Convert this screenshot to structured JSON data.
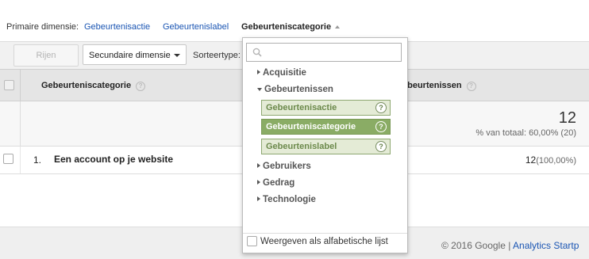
{
  "primary": {
    "label": "Primaire dimensie:",
    "links": [
      "Gebeurtenisactie",
      "Gebeurtenislabel"
    ],
    "active": "Gebeurteniscategorie"
  },
  "toolbar": {
    "rows_button": "Rijen weergeven",
    "secondary_dimension": "Secundaire dimensie",
    "sort_label": "Sorteertype:"
  },
  "table": {
    "col_category": "Gebeurteniscategorie",
    "col_events": "ebeurtenissen",
    "help_glyph": "?",
    "totals": {
      "value": "12",
      "pct": "% van totaal: 60,00% (20)"
    },
    "rows": [
      {
        "index": "1.",
        "name": "Een account op je website",
        "value": "12",
        "pct": "(100,00%)"
      }
    ]
  },
  "footer": {
    "copyright": "© 2016 Google |",
    "link": "Analytics Startp"
  },
  "dropdown": {
    "search_placeholder": "",
    "groups": [
      {
        "label": "Acquisitie",
        "expanded": false
      },
      {
        "label": "Gebeurtenissen",
        "expanded": true
      },
      {
        "label": "Gebruikers",
        "expanded": false
      },
      {
        "label": "Gedrag",
        "expanded": false
      },
      {
        "label": "Technologie",
        "expanded": false
      }
    ],
    "options": [
      {
        "label": "Gebeurtenisactie",
        "selected": false
      },
      {
        "label": "Gebeurteniscategorie",
        "selected": true
      },
      {
        "label": "Gebeurtenislabel",
        "selected": false
      }
    ],
    "alpha_label": "Weergeven als alfabetische lijst"
  },
  "colors": {
    "link": "#1a55b3",
    "option_bg": "#e4ebd6",
    "option_selected_bg": "#8aac65"
  }
}
